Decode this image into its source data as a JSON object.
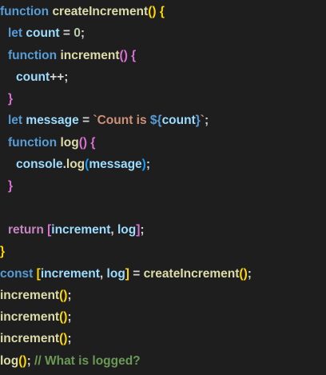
{
  "editor": {
    "background": "#1e1e1e",
    "palette": {
      "keyword": "#569cd6",
      "control": "#c586c0",
      "function": "#dcdcaa",
      "variable": "#9cdcfe",
      "number": "#b5cea8",
      "string": "#ce9178",
      "comment": "#6a9955",
      "punct": "#d4d4d4",
      "bracket_gold": "#ffd700",
      "bracket_purple": "#da70d6",
      "bracket_blue": "#179fff"
    },
    "lines": [
      {
        "indent": 0,
        "tokens": [
          {
            "t": "function",
            "c": "keyword"
          },
          {
            "t": " ",
            "c": "punct"
          },
          {
            "t": "createIncrement",
            "c": "function"
          },
          {
            "t": "() {",
            "c": "bracket_gold"
          }
        ]
      },
      {
        "indent": 1,
        "tokens": [
          {
            "t": "let",
            "c": "keyword"
          },
          {
            "t": " ",
            "c": "punct"
          },
          {
            "t": "count",
            "c": "variable"
          },
          {
            "t": " = ",
            "c": "punct"
          },
          {
            "t": "0",
            "c": "number"
          },
          {
            "t": ";",
            "c": "punct"
          }
        ]
      },
      {
        "indent": 1,
        "tokens": [
          {
            "t": "function",
            "c": "keyword"
          },
          {
            "t": " ",
            "c": "punct"
          },
          {
            "t": "increment",
            "c": "function"
          },
          {
            "t": "() {",
            "c": "bracket_purple"
          }
        ]
      },
      {
        "indent": 2,
        "tokens": [
          {
            "t": "count",
            "c": "variable"
          },
          {
            "t": "++;",
            "c": "punct"
          }
        ]
      },
      {
        "indent": 1,
        "tokens": [
          {
            "t": "}",
            "c": "bracket_purple"
          }
        ]
      },
      {
        "indent": 1,
        "tokens": [
          {
            "t": "let",
            "c": "keyword"
          },
          {
            "t": " ",
            "c": "punct"
          },
          {
            "t": "message",
            "c": "variable"
          },
          {
            "t": " = ",
            "c": "punct"
          },
          {
            "t": "`Count is ",
            "c": "string"
          },
          {
            "t": "${",
            "c": "keyword"
          },
          {
            "t": "count",
            "c": "variable"
          },
          {
            "t": "}",
            "c": "keyword"
          },
          {
            "t": "`",
            "c": "string"
          },
          {
            "t": ";",
            "c": "punct"
          }
        ]
      },
      {
        "indent": 1,
        "tokens": [
          {
            "t": "function",
            "c": "keyword"
          },
          {
            "t": " ",
            "c": "punct"
          },
          {
            "t": "log",
            "c": "function"
          },
          {
            "t": "() {",
            "c": "bracket_purple"
          }
        ]
      },
      {
        "indent": 2,
        "tokens": [
          {
            "t": "console",
            "c": "variable"
          },
          {
            "t": ".",
            "c": "punct"
          },
          {
            "t": "log",
            "c": "function"
          },
          {
            "t": "(",
            "c": "bracket_blue"
          },
          {
            "t": "message",
            "c": "variable"
          },
          {
            "t": ")",
            "c": "bracket_blue"
          },
          {
            "t": ";",
            "c": "punct"
          }
        ]
      },
      {
        "indent": 1,
        "tokens": [
          {
            "t": "}",
            "c": "bracket_purple"
          }
        ]
      },
      {
        "indent": 0,
        "tokens": []
      },
      {
        "indent": 1,
        "tokens": [
          {
            "t": "return",
            "c": "control"
          },
          {
            "t": " ",
            "c": "punct"
          },
          {
            "t": "[",
            "c": "bracket_purple"
          },
          {
            "t": "increment",
            "c": "variable"
          },
          {
            "t": ", ",
            "c": "punct"
          },
          {
            "t": "log",
            "c": "variable"
          },
          {
            "t": "]",
            "c": "bracket_purple"
          },
          {
            "t": ";",
            "c": "punct"
          }
        ]
      },
      {
        "indent": 0,
        "tokens": [
          {
            "t": "}",
            "c": "bracket_gold"
          }
        ]
      },
      {
        "indent": 0,
        "tokens": [
          {
            "t": "const",
            "c": "keyword"
          },
          {
            "t": " ",
            "c": "punct"
          },
          {
            "t": "[",
            "c": "bracket_gold"
          },
          {
            "t": "increment",
            "c": "variable"
          },
          {
            "t": ", ",
            "c": "punct"
          },
          {
            "t": "log",
            "c": "variable"
          },
          {
            "t": "]",
            "c": "bracket_gold"
          },
          {
            "t": " = ",
            "c": "punct"
          },
          {
            "t": "createIncrement",
            "c": "function"
          },
          {
            "t": "()",
            "c": "bracket_gold"
          },
          {
            "t": ";",
            "c": "punct"
          }
        ]
      },
      {
        "indent": 0,
        "tokens": [
          {
            "t": "increment",
            "c": "function"
          },
          {
            "t": "()",
            "c": "bracket_gold"
          },
          {
            "t": ";",
            "c": "punct"
          }
        ]
      },
      {
        "indent": 0,
        "tokens": [
          {
            "t": "increment",
            "c": "function"
          },
          {
            "t": "()",
            "c": "bracket_gold"
          },
          {
            "t": ";",
            "c": "punct"
          }
        ]
      },
      {
        "indent": 0,
        "tokens": [
          {
            "t": "increment",
            "c": "function"
          },
          {
            "t": "()",
            "c": "bracket_gold"
          },
          {
            "t": ";",
            "c": "punct"
          }
        ]
      },
      {
        "indent": 0,
        "tokens": [
          {
            "t": "log",
            "c": "function"
          },
          {
            "t": "()",
            "c": "bracket_gold"
          },
          {
            "t": "; ",
            "c": "punct"
          },
          {
            "t": "// What is logged?",
            "c": "comment"
          }
        ]
      }
    ]
  }
}
